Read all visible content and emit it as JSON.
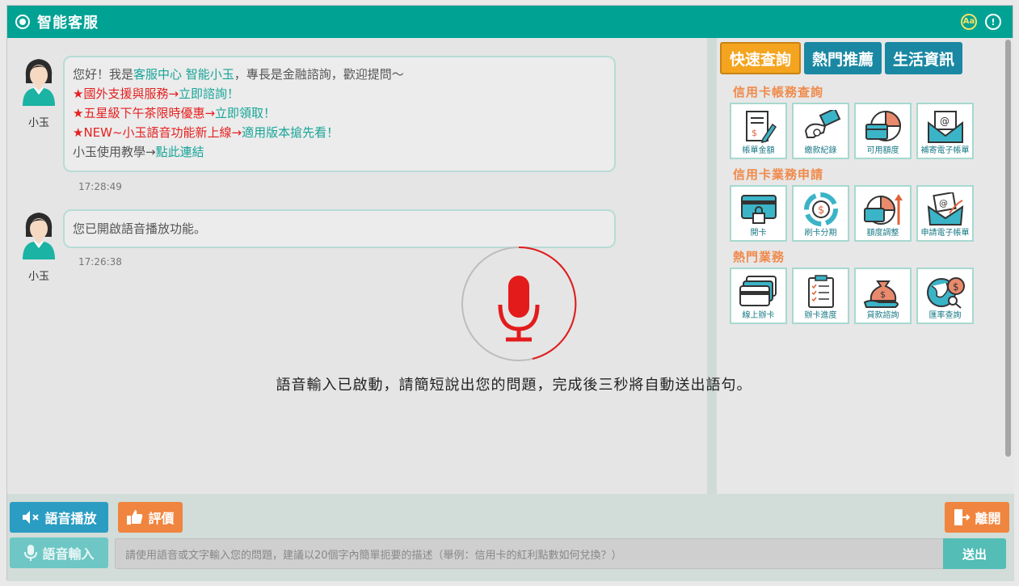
{
  "window": {
    "title": "智能客服"
  },
  "title_icons": {
    "font_icon": "Aa"
  },
  "messages": [
    {
      "name": "小玉",
      "time": "17:28:49",
      "line1": {
        "pre": "您好！我是",
        "highlight": "客服中心 智能小玉",
        "post": "，專長是金融諮詢，歡迎提問～"
      },
      "line2": {
        "red": "★國外支援與服務",
        "arrow": "→",
        "link": "立即諮詢！"
      },
      "line3": {
        "red": "★五星級下午茶限時優惠",
        "arrow": "→",
        "link": "立即領取！"
      },
      "line4": {
        "red": "★NEW~小玉語音功能新上線",
        "arrow": "→",
        "link": "適用版本搶先看！"
      },
      "line5": {
        "pre": "小玉使用教學→",
        "link": "點此連結"
      }
    },
    {
      "name": "小玉",
      "time": "17:26:38",
      "text": "您已開啟語音播放功能。"
    }
  ],
  "voice_overlay": {
    "text": "語音輸入已啟動，請簡短說出您的問題，完成後三秒將自動送出語句。"
  },
  "tabs": [
    "快速查詢",
    "熱門推薦",
    "生活資訊"
  ],
  "sections": [
    {
      "title": "信用卡帳務查詢",
      "tiles": [
        {
          "label": "帳單金額",
          "icon": "bill-icon"
        },
        {
          "label": "繳款紀錄",
          "icon": "payment-hand-icon"
        },
        {
          "label": "可用額度",
          "icon": "credit-pie-icon"
        },
        {
          "label": "補寄電子帳單",
          "icon": "email-icon"
        }
      ]
    },
    {
      "title": "信用卡業務申請",
      "tiles": [
        {
          "label": "開卡",
          "icon": "card-lock-icon"
        },
        {
          "label": "刷卡分期",
          "icon": "installment-icon"
        },
        {
          "label": "額度調整",
          "icon": "limit-up-icon"
        },
        {
          "label": "申請電子帳單",
          "icon": "ebill-apply-icon"
        }
      ]
    },
    {
      "title": "熱門業務",
      "tiles": [
        {
          "label": "線上辦卡",
          "icon": "cards-icon"
        },
        {
          "label": "辦卡進度",
          "icon": "clipboard-icon"
        },
        {
          "label": "貸款諮詢",
          "icon": "money-bag-icon"
        },
        {
          "label": "匯率查詢",
          "icon": "globe-dollar-icon"
        }
      ]
    }
  ],
  "bottom": {
    "voice_play": "語音播放",
    "rate": "評價",
    "leave": "離開",
    "voice_input": "語音輸入",
    "input_placeholder": "請使用語音或文字輸入您的問題，建議以20個字內簡單扼要的描述（舉例：信用卡的紅利點數如何兌換？）",
    "send": "送出"
  },
  "colors": {
    "brand": "#00a294",
    "accent": "#f4a41e",
    "tab_blue": "#1a88a3",
    "red": "#e52020",
    "mic_red": "#e31b1b"
  }
}
